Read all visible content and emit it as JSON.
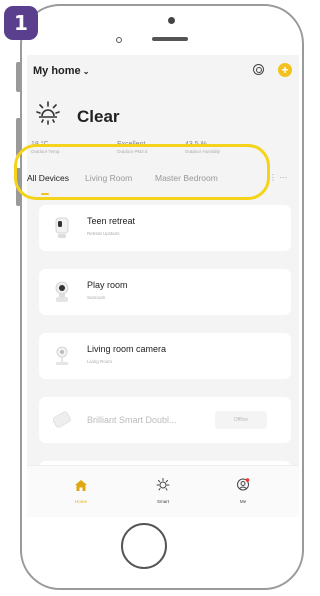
{
  "step_number": "1",
  "header": {
    "home_title": "My home",
    "home_chevron": "⌄"
  },
  "weather": {
    "condition": "Clear",
    "icon": "sun-icon"
  },
  "stats": [
    {
      "value": "18 °C",
      "label": "Outdoor Temp."
    },
    {
      "value": "Excellent",
      "label": "Outdoor PM2.5"
    },
    {
      "value": "43.5 %",
      "label": "Outdoor Humidity"
    }
  ],
  "tabs": [
    "All Devices",
    "Living Room",
    "Master Bedroom"
  ],
  "tabs_more": "⋮ ···",
  "devices": [
    {
      "name": "Teen retreat",
      "sub": "Retreat Upstairs",
      "icon": "camera-icon"
    },
    {
      "name": "Play room",
      "sub": "Sunroom",
      "icon": "camera-icon"
    },
    {
      "name": "Living room camera",
      "sub": "Living Room",
      "icon": "camera-icon"
    },
    {
      "name": "Brilliant Smart Doubl...",
      "sub": "",
      "icon": "power-board-icon",
      "status": "Offline"
    }
  ],
  "bottom_nav": [
    {
      "label": "Home",
      "icon": "home-icon"
    },
    {
      "label": "Smart",
      "icon": "smart-sun-icon"
    },
    {
      "label": "Me",
      "icon": "profile-icon"
    }
  ],
  "colors": {
    "accent": "#f4c21e",
    "highlight": "#f4d31b",
    "badge": "#5a3f8e"
  }
}
